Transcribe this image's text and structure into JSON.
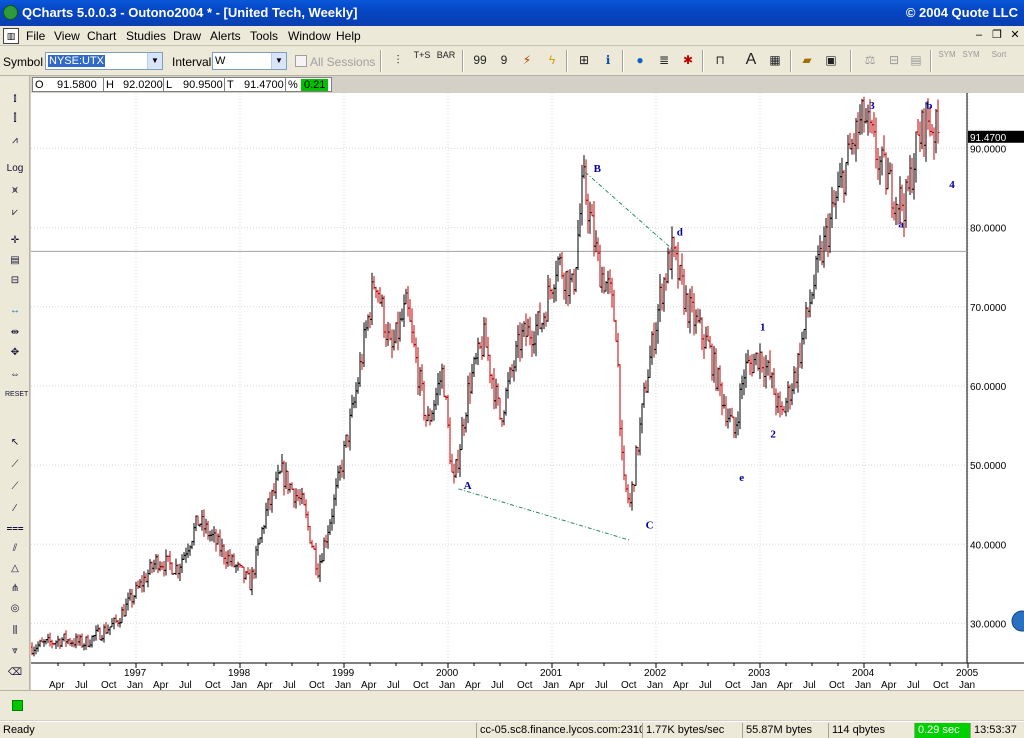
{
  "window": {
    "title": "QCharts 5.0.0.3 - Outono2004 * - [United Tech, Weekly]",
    "copyright": "© 2004 Quote LLC"
  },
  "menu": [
    "File",
    "View",
    "Chart",
    "Studies",
    "Draw",
    "Alerts",
    "Tools",
    "Window",
    "Help"
  ],
  "toolbar": {
    "symbol_label": "Symbol",
    "symbol_value": "NYSE:UTX",
    "interval_label": "Interval",
    "interval_value": "W",
    "all_sessions_label": "All Sessions",
    "tool_labels": {
      "tas": "T+S",
      "bar": "BAR",
      "sym1": "SYM",
      "sym2": "SYM",
      "sort": "Sort"
    }
  },
  "ohlc": {
    "o_label": "O",
    "o": "91.5800",
    "h_label": "H",
    "h": "92.0200",
    "l_label": "L",
    "l": "90.9500",
    "t_label": "T",
    "t": "91.4700",
    "pct_label": "%",
    "pct": "0.21"
  },
  "left_tools": {
    "log": "Log",
    "reset": "RESET"
  },
  "chart_data": {
    "type": "bar",
    "symbol": "NYSE:UTX",
    "interval": "Weekly",
    "x_range": [
      "1996-01",
      "2005-01"
    ],
    "ylim": [
      25,
      97
    ],
    "y_ticks": [
      "30.0000",
      "40.0000",
      "50.0000",
      "60.0000",
      "70.0000",
      "80.0000",
      "90.0000"
    ],
    "y_tick_values": [
      30,
      40,
      50,
      60,
      70,
      80,
      90
    ],
    "last_price_label": "91.4700",
    "last_price": 91.47,
    "crosshair_y": 77,
    "x_year_labels": [
      "1997",
      "1998",
      "1999",
      "2000",
      "2001",
      "2002",
      "2003",
      "2004",
      "2005"
    ],
    "x_month_labels": [
      {
        "t": 1996.25,
        "m": "Apr"
      },
      {
        "t": 1996.5,
        "m": "Jul"
      },
      {
        "t": 1996.75,
        "m": "Oct"
      },
      {
        "t": 1997.0,
        "m": "Jan"
      },
      {
        "t": 1997.25,
        "m": "Apr"
      },
      {
        "t": 1997.5,
        "m": "Jul"
      },
      {
        "t": 1997.75,
        "m": "Oct"
      },
      {
        "t": 1998.0,
        "m": "Jan"
      },
      {
        "t": 1998.25,
        "m": "Apr"
      },
      {
        "t": 1998.5,
        "m": "Jul"
      },
      {
        "t": 1998.75,
        "m": "Oct"
      },
      {
        "t": 1999.0,
        "m": "Jan"
      },
      {
        "t": 1999.25,
        "m": "Apr"
      },
      {
        "t": 1999.5,
        "m": "Jul"
      },
      {
        "t": 1999.75,
        "m": "Oct"
      },
      {
        "t": 2000.0,
        "m": "Jan"
      },
      {
        "t": 2000.25,
        "m": "Apr"
      },
      {
        "t": 2000.5,
        "m": "Jul"
      },
      {
        "t": 2000.75,
        "m": "Oct"
      },
      {
        "t": 2001.0,
        "m": "Jan"
      },
      {
        "t": 2001.25,
        "m": "Apr"
      },
      {
        "t": 2001.5,
        "m": "Jul"
      },
      {
        "t": 2001.75,
        "m": "Oct"
      },
      {
        "t": 2002.0,
        "m": "Jan"
      },
      {
        "t": 2002.25,
        "m": "Apr"
      },
      {
        "t": 2002.5,
        "m": "Jul"
      },
      {
        "t": 2002.75,
        "m": "Oct"
      },
      {
        "t": 2003.0,
        "m": "Jan"
      },
      {
        "t": 2003.25,
        "m": "Apr"
      },
      {
        "t": 2003.5,
        "m": "Jul"
      },
      {
        "t": 2003.75,
        "m": "Oct"
      },
      {
        "t": 2004.0,
        "m": "Jan"
      },
      {
        "t": 2004.25,
        "m": "Apr"
      },
      {
        "t": 2004.5,
        "m": "Jul"
      },
      {
        "t": 2004.75,
        "m": "Oct"
      },
      {
        "t": 2005.0,
        "m": "Jan"
      }
    ],
    "price_path": [
      [
        1996.0,
        27
      ],
      [
        1996.3,
        28
      ],
      [
        1996.5,
        27.5
      ],
      [
        1996.8,
        30
      ],
      [
        1997.0,
        34
      ],
      [
        1997.2,
        38
      ],
      [
        1997.4,
        37
      ],
      [
        1997.6,
        43
      ],
      [
        1997.9,
        38
      ],
      [
        1998.1,
        35
      ],
      [
        1998.25,
        44
      ],
      [
        1998.4,
        49
      ],
      [
        1998.6,
        45
      ],
      [
        1998.75,
        37
      ],
      [
        1998.9,
        45
      ],
      [
        1999.1,
        58
      ],
      [
        1999.3,
        74
      ],
      [
        1999.45,
        64
      ],
      [
        1999.6,
        70
      ],
      [
        1999.8,
        55
      ],
      [
        1999.95,
        62
      ],
      [
        2000.05,
        47
      ],
      [
        2000.2,
        60
      ],
      [
        2000.35,
        66
      ],
      [
        2000.5,
        56
      ],
      [
        2000.7,
        66
      ],
      [
        2000.9,
        68
      ],
      [
        2001.05,
        76
      ],
      [
        2001.2,
        72
      ],
      [
        2001.3,
        86
      ],
      [
        2001.45,
        75
      ],
      [
        2001.55,
        72
      ],
      [
        2001.62,
        67
      ],
      [
        2001.68,
        48
      ],
      [
        2001.75,
        45
      ],
      [
        2001.9,
        60
      ],
      [
        2002.05,
        72
      ],
      [
        2002.15,
        77
      ],
      [
        2002.3,
        70
      ],
      [
        2002.5,
        65
      ],
      [
        2002.65,
        58
      ],
      [
        2002.75,
        54
      ],
      [
        2002.85,
        62
      ],
      [
        2003.0,
        64
      ],
      [
        2003.1,
        61
      ],
      [
        2003.2,
        56
      ],
      [
        2003.35,
        62
      ],
      [
        2003.5,
        72
      ],
      [
        2003.7,
        82
      ],
      [
        2003.9,
        91
      ],
      [
        2004.0,
        94
      ],
      [
        2004.15,
        88
      ],
      [
        2004.3,
        84
      ],
      [
        2004.4,
        83
      ],
      [
        2004.5,
        90
      ],
      [
        2004.6,
        94
      ],
      [
        2004.72,
        91.5
      ]
    ],
    "wave_labels": [
      {
        "text": "A",
        "t": 2000.15,
        "v": 47
      },
      {
        "text": "B",
        "t": 2001.4,
        "v": 87
      },
      {
        "text": "C",
        "t": 2001.9,
        "v": 42
      },
      {
        "text": "d",
        "t": 2002.2,
        "v": 79
      },
      {
        "text": "e",
        "t": 2002.8,
        "v": 48
      },
      {
        "text": "1",
        "t": 2003.0,
        "v": 67
      },
      {
        "text": "2",
        "t": 2003.1,
        "v": 53.5
      },
      {
        "text": "3",
        "t": 2004.05,
        "v": 95
      },
      {
        "text": "a",
        "t": 2004.33,
        "v": 80
      },
      {
        "text": "b",
        "t": 2004.6,
        "v": 95
      },
      {
        "text": "4",
        "t": 2004.82,
        "v": 85
      }
    ],
    "trendlines": [
      {
        "from": [
          2000.1,
          47
        ],
        "to": [
          2001.75,
          40.5
        ]
      },
      {
        "from": [
          2001.32,
          87
        ],
        "to": [
          2002.18,
          77
        ]
      }
    ],
    "colors": {
      "up": "#000000",
      "down": "#c00000",
      "trendline": "#2a8a6a",
      "labels": "#0000a0",
      "grid": "#d8d8d8"
    }
  },
  "status": {
    "ready": "Ready",
    "server": "cc-05.sc8.finance.lycos.com:2310",
    "rate": "1.77K bytes/sec",
    "memory": "55.87M bytes",
    "qbytes": "114 qbytes",
    "latency": "0.29 sec",
    "time": "13:53:37"
  }
}
